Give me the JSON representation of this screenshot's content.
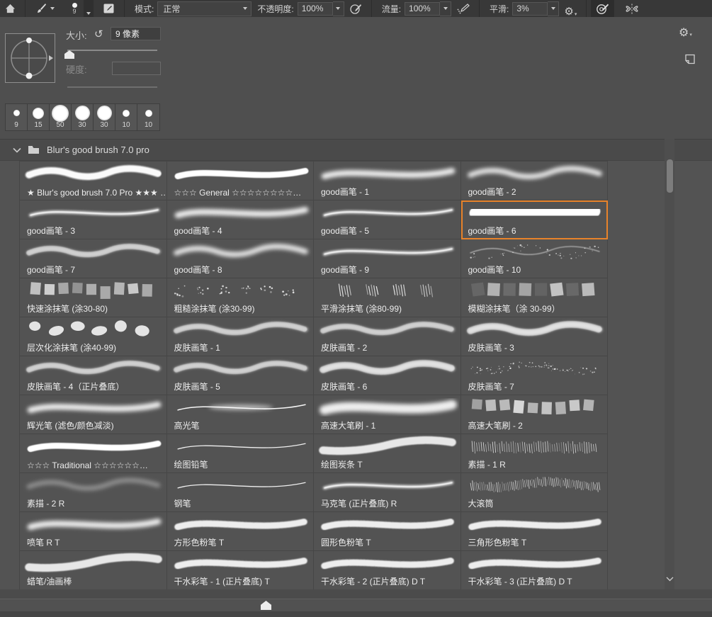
{
  "colors": {
    "accent": "#e8832a",
    "toolbar_bg": "#383838",
    "panel_bg": "#4f4f4f",
    "list_bg": "#535353",
    "cell_border": "#464646",
    "header_bg": "#4a4a4a"
  },
  "toolbar": {
    "brush_size_indicator": "9",
    "mode_label": "模式:",
    "mode_value": "正常",
    "opacity_label": "不透明度:",
    "opacity_value": "100%",
    "flow_label": "流量:",
    "flow_value": "100%",
    "smoothing_label": "平滑:",
    "smoothing_value": "3%"
  },
  "brush_settings": {
    "size_label": "大小:",
    "size_value": "9 像素",
    "hardness_label": "硬度:",
    "hardness_value": ""
  },
  "presets": {
    "items": [
      {
        "label": "9",
        "dot": 9
      },
      {
        "label": "15",
        "dot": 16
      },
      {
        "label": "50",
        "dot": 24
      },
      {
        "label": "30",
        "dot": 21
      },
      {
        "label": "30",
        "dot": 21
      },
      {
        "label": "10",
        "dot": 10
      },
      {
        "label": "10",
        "dot": 10
      }
    ]
  },
  "folder": {
    "title": "Blur's good brush 7.0 pro"
  },
  "grid": {
    "columns": 4,
    "cells": [
      {
        "label": "★ Blur's good brush 7.0 Pro ★★★ …",
        "thumb": "rope"
      },
      {
        "label": "☆☆☆ General ☆☆☆☆☆☆☆☆…",
        "thumb": "smooth"
      },
      {
        "label": "good画笔 - 1",
        "thumb": "soft"
      },
      {
        "label": "good画笔 - 2",
        "thumb": "softwave"
      },
      {
        "label": "good画笔 - 3",
        "thumb": "taper"
      },
      {
        "label": "good画笔 - 4",
        "thumb": "soft"
      },
      {
        "label": "good画笔 - 5",
        "thumb": "taper"
      },
      {
        "label": "good画笔 - 6",
        "thumb": "blob",
        "selected": true
      },
      {
        "label": "good画笔 - 7",
        "thumb": "grain"
      },
      {
        "label": "good画笔 - 8",
        "thumb": "softwave"
      },
      {
        "label": "good画笔 - 9",
        "thumb": "taper"
      },
      {
        "label": "good画笔 - 10",
        "thumb": "scatter"
      },
      {
        "label": "快速涂抹笔 (涂30-80)",
        "thumb": "squares"
      },
      {
        "label": "粗糙涂抹笔 (涂30-99)",
        "thumb": "dots"
      },
      {
        "label": "平滑涂抹笔 (涂80-99)",
        "thumb": "hatch"
      },
      {
        "label": "模糊涂抹笔（涂 30-99）",
        "thumb": "stamps"
      },
      {
        "label": "层次化涂抹笔 (涂40-99)",
        "thumb": "rocks"
      },
      {
        "label": "皮肤画笔 - 1",
        "thumb": "grain"
      },
      {
        "label": "皮肤画笔 - 2",
        "thumb": "grain"
      },
      {
        "label": "皮肤画笔 - 3",
        "thumb": "graind"
      },
      {
        "label": "皮肤画笔 - 4（正片叠底）",
        "thumb": "grain"
      },
      {
        "label": "皮肤画笔 - 5",
        "thumb": "grain"
      },
      {
        "label": "皮肤画笔 - 6",
        "thumb": "graind"
      },
      {
        "label": "皮肤画笔 - 7",
        "thumb": "stipple"
      },
      {
        "label": "辉光笔 (滤色/颜色减淡)",
        "thumb": "soft"
      },
      {
        "label": "高光笔",
        "thumb": "thinbulge"
      },
      {
        "label": "高速大笔刷 - 1",
        "thumb": "widesoft"
      },
      {
        "label": "高速大笔刷 - 2",
        "thumb": "squares"
      },
      {
        "label": "☆☆☆ Traditional ☆☆☆☆☆☆…",
        "thumb": "smooth"
      },
      {
        "label": "绘图铅笔",
        "thumb": "thin"
      },
      {
        "label": "绘图炭条 T",
        "thumb": "charcoal"
      },
      {
        "label": "素描 - 1 R",
        "thumb": "finehatch"
      },
      {
        "label": "素描 - 2 R",
        "thumb": "faint"
      },
      {
        "label": "钢笔",
        "thumb": "thin"
      },
      {
        "label": "马克笔 (正片叠底) R",
        "thumb": "taper"
      },
      {
        "label": "大滚筒",
        "thumb": "bristle"
      },
      {
        "label": "喷笔 R T",
        "thumb": "soft"
      },
      {
        "label": "方形色粉笔 T",
        "thumb": "chalk"
      },
      {
        "label": "圆形色粉笔 T",
        "thumb": "chalk"
      },
      {
        "label": "三角形色粉笔 T",
        "thumb": "chalk"
      },
      {
        "label": "蜡笔/油画棒",
        "thumb": "charcoal"
      },
      {
        "label": "干水彩笔 - 1 (正片叠底) T",
        "thumb": "chalk"
      },
      {
        "label": "干水彩笔 - 2 (正片叠底) D T",
        "thumb": "chalk"
      },
      {
        "label": "干水彩笔 - 3 (正片叠底) D T",
        "thumb": "chalk"
      }
    ]
  }
}
